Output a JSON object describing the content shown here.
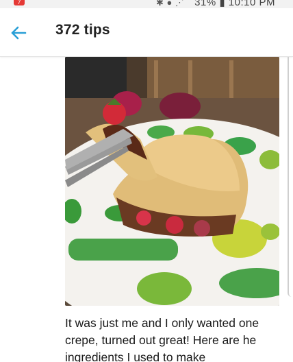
{
  "status_bar": {
    "notification_count": "7",
    "battery_text": "31%",
    "time": "10:10 PM",
    "icons": [
      "bluetooth-icon",
      "mute-icon",
      "wifi-icon",
      "signal-icon",
      "battery-icon"
    ]
  },
  "header": {
    "back_icon": "arrow-left-icon",
    "title": "372 tips"
  },
  "tip": {
    "photo_description_icon": "photo",
    "text": "It was just me and I only wanted one crepe, turned out great! Here are he ingredients I used to make"
  },
  "colors": {
    "accent": "#2a9fd6",
    "status_bar_bg": "#f2f2f2",
    "badge": "#e53935"
  }
}
